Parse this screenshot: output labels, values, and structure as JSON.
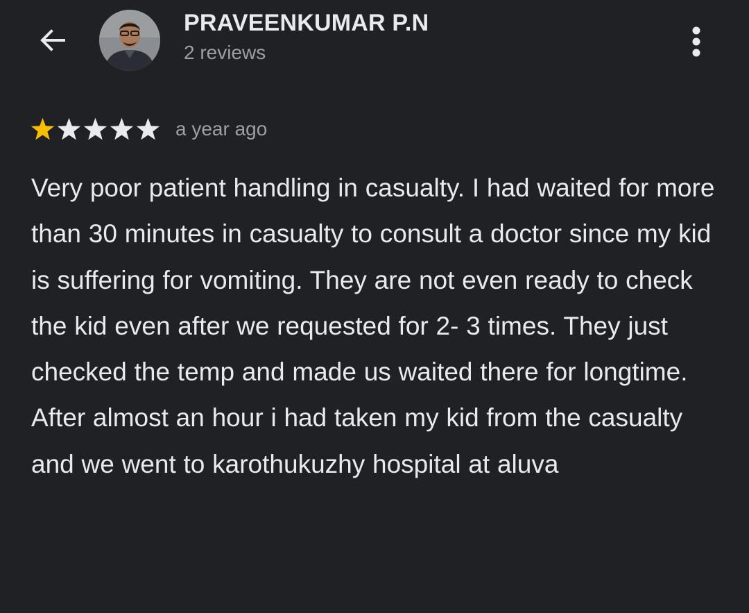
{
  "header": {
    "back_icon": "arrow-left-icon",
    "more_icon": "more-vert-icon",
    "reviewer_name": "PRAVEENKUMAR P.N",
    "reviewer_reviews": "2 reviews"
  },
  "review": {
    "rating": 1,
    "max_rating": 5,
    "time": "a year ago",
    "text": "Very poor patient handling in casualty. I had waited for more than 30 minutes in casualty to consult a doctor since my kid is suffering for vomiting. They are not even ready to check the kid even after we requested for 2- 3 times. They just checked the temp and made us waited there for longtime. After almost an hour i had taken my kid from the casualty and we went to karothukuzhy hospital at aluva"
  },
  "colors": {
    "background": "#202124",
    "text_primary": "#e8eaed",
    "text_secondary": "#9aa0a6",
    "star_filled": "#fbbc04",
    "star_empty": "#e8eaed"
  }
}
